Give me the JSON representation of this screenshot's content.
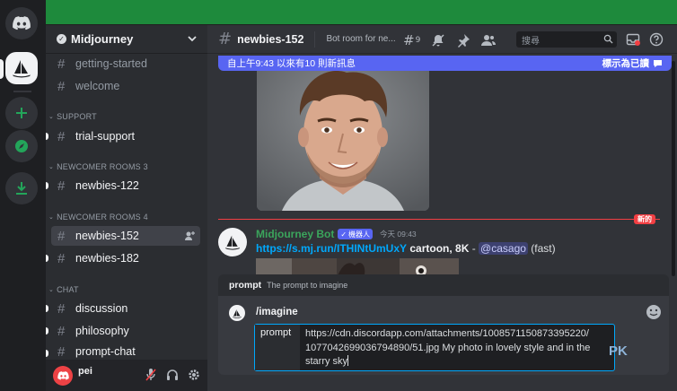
{
  "server": {
    "name": "Midjourney"
  },
  "channels": {
    "top": [
      {
        "label": "getting-started"
      },
      {
        "label": "welcome"
      }
    ],
    "categories": [
      {
        "name": "SUPPORT"
      },
      {
        "name": "NEWCOMER ROOMS 3"
      },
      {
        "name": "NEWCOMER ROOMS 4"
      },
      {
        "name": "CHAT"
      }
    ],
    "support": [
      {
        "label": "trial-support"
      }
    ],
    "newcomer3": [
      {
        "label": "newbies-122"
      }
    ],
    "newcomer4": [
      {
        "label": "newbies-152"
      },
      {
        "label": "newbies-182"
      }
    ],
    "chat": [
      {
        "label": "discussion"
      },
      {
        "label": "philosophy"
      },
      {
        "label": "prompt-chat"
      }
    ]
  },
  "user": {
    "name": "pei"
  },
  "header": {
    "channel": "newbies-152",
    "topic": "Bot room for ne...",
    "threads_count": "9",
    "search_placeholder": "搜尋"
  },
  "banner": {
    "text": "自上午9:43 以來有10 則新訊息",
    "mark_read": "標示為已讀"
  },
  "divider": {
    "new_label": "新的"
  },
  "message": {
    "author": "Midjourney Bot",
    "badge": "機器人",
    "time": "今天 09:43",
    "link": "https://s.mj.run/ITHINtUmUxY",
    "prompt_bold": "cartoon, 8K",
    "separator": " - ",
    "mention": "@casago",
    "mode": " (fast)"
  },
  "command": {
    "hint_name": "prompt",
    "hint_desc": "The prompt to imagine",
    "name": "/imagine",
    "option_label": "prompt",
    "option_value": "https://cdn.discordapp.com/attachments/1008571150873395220/\n1077042699036794890/51.jpg  My photo in lovely style and in the\nstarry sky"
  },
  "watermark": "PK",
  "colors": {
    "accent": "#5865f2",
    "online_green": "#23a55a",
    "bot_name": "#3ba55c",
    "new_red": "#f23f43",
    "link": "#00a8fc"
  },
  "icons": [
    "discord-icon",
    "midjourney-icon",
    "add-server-icon",
    "explore-icon",
    "download-icon",
    "hash-icon",
    "threads-icon",
    "mute-icon",
    "pin-icon",
    "members-icon",
    "search-icon",
    "inbox-icon",
    "help-icon",
    "mic-muted-icon",
    "headphones-icon",
    "settings-icon",
    "add-member-icon",
    "emoji-icon",
    "mark-read-icon"
  ]
}
